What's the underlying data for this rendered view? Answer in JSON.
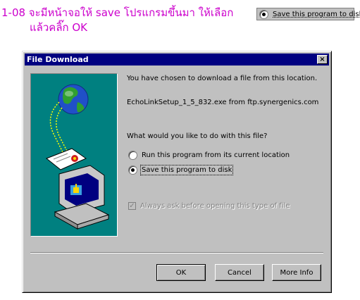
{
  "caption": {
    "line1": "1-08 จะมีหน้าจอให้ save โปรแกรมขึ้นมา ให้เลือก",
    "line2": "แล้วคลิ๊ก  OK"
  },
  "sample_option": {
    "label": "Save this program to disk"
  },
  "dialog": {
    "title": "File Download",
    "close_glyph": "×",
    "message": "You have chosen to download a file from this location.",
    "file": "EchoLinkSetup_1_5_832.exe from ftp.synergenics.com",
    "question": "What would you like to do with this file?",
    "options": [
      {
        "label": "Run this program from its current location",
        "selected": false
      },
      {
        "label": "Save this program to disk",
        "selected": true
      }
    ],
    "always_ask": {
      "label": "Always ask before opening this type of file",
      "checked": true,
      "enabled": false
    },
    "buttons": {
      "ok": "OK",
      "cancel": "Cancel",
      "more_info": "More Info"
    }
  },
  "colors": {
    "title_bar": "#000080",
    "caption": "#cc00cc",
    "art_bg": "#008080",
    "face": "#c0c0c0"
  },
  "icons": [
    "globe-icon",
    "certificate-icon",
    "computer-icon",
    "close-icon"
  ]
}
